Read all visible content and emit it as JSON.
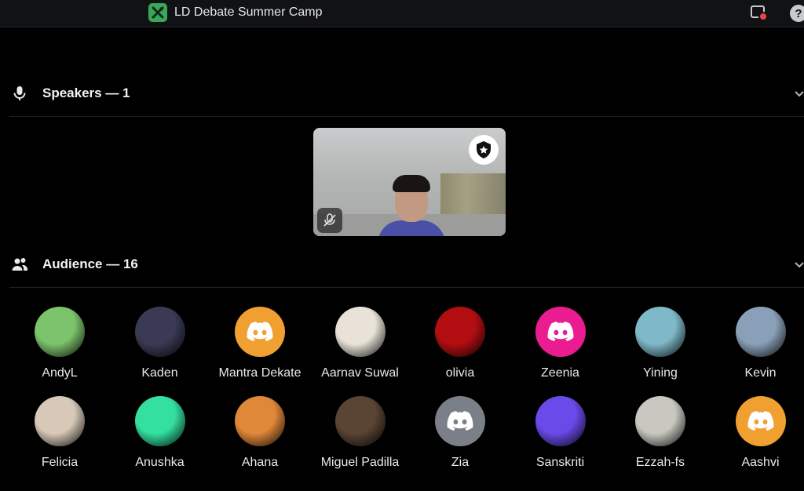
{
  "header": {
    "server_name": "LD Debate Summer Camp",
    "help_label": "?"
  },
  "speakers": {
    "title": "Speakers — 1",
    "speaker_name": ""
  },
  "audience": {
    "title": "Audience — 16",
    "members": [
      {
        "name": "AndyL",
        "avatar": "photo",
        "color": "#7cc36b"
      },
      {
        "name": "Kaden",
        "avatar": "photo",
        "color": "#3a3a55"
      },
      {
        "name": "Mantra Dekate",
        "avatar": "discord-default",
        "color": "#f0a030"
      },
      {
        "name": "Aarnav Suwal",
        "avatar": "photo",
        "color": "#e8e2d8"
      },
      {
        "name": "olivia",
        "avatar": "photo",
        "color": "#b20e12"
      },
      {
        "name": "Zeenia",
        "avatar": "discord-default",
        "color": "#eb1c8f"
      },
      {
        "name": "Yining",
        "avatar": "photo",
        "color": "#7fb8c8"
      },
      {
        "name": "Kevin",
        "avatar": "photo",
        "color": "#8aa0b8"
      },
      {
        "name": "Felicia",
        "avatar": "photo",
        "color": "#d7c8b8"
      },
      {
        "name": "Anushka",
        "avatar": "photo",
        "color": "#33e0a0"
      },
      {
        "name": "Ahana",
        "avatar": "photo",
        "color": "#e0883a"
      },
      {
        "name": "Miguel Padilla",
        "avatar": "photo",
        "color": "#5a4434"
      },
      {
        "name": "Zia",
        "avatar": "discord-default",
        "color": "#7b7f87"
      },
      {
        "name": "Sanskriti",
        "avatar": "photo",
        "color": "#6a4ae8"
      },
      {
        "name": "Ezzah-fs",
        "avatar": "photo",
        "color": "#c8c8c0"
      },
      {
        "name": "Aashvi",
        "avatar": "discord-default",
        "color": "#f0a030"
      }
    ]
  },
  "colors": {
    "accent_green": "#3ba55c",
    "background": "#000000",
    "divider": "#1f2023"
  }
}
